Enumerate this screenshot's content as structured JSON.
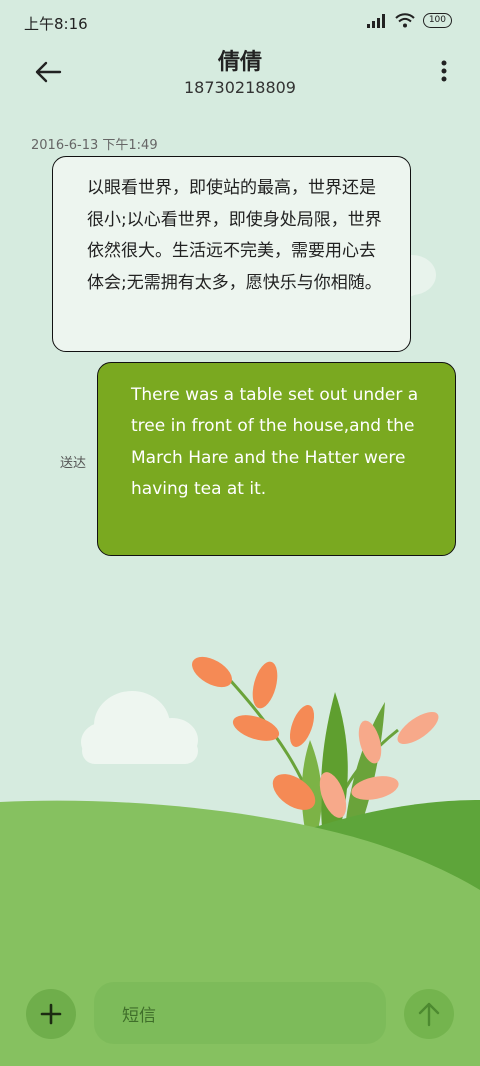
{
  "status_bar": {
    "time": "上午8:16",
    "battery": "100"
  },
  "header": {
    "contact_name": "倩倩",
    "contact_number": "18730218809"
  },
  "conversation": {
    "timestamp": "2016-6-13 下午1:49",
    "incoming_text": "以眼看世界，即使站的最高，世界还是很小;以心看世界，即使身处局限，世界依然很大。生活远不完美，需要用心去体会;无需拥有太多，愿快乐与你相随。",
    "outgoing_text": "There was a table set out under a tree in front of the house,and the March Hare and the Hatter were having tea at it.",
    "delivery_status": "送达"
  },
  "composer": {
    "placeholder": "短信"
  },
  "colors": {
    "background": "#d6ebdf",
    "outgoing_bubble": "#7aa920",
    "incoming_bubble": "#edf5ef",
    "hill_light": "#86c160",
    "hill_dark": "#5ea53a",
    "leaf": "#f58a55"
  },
  "icons": {
    "back": "arrow-left-icon",
    "more": "more-vertical-icon",
    "add": "plus-icon",
    "send": "arrow-up-icon"
  }
}
